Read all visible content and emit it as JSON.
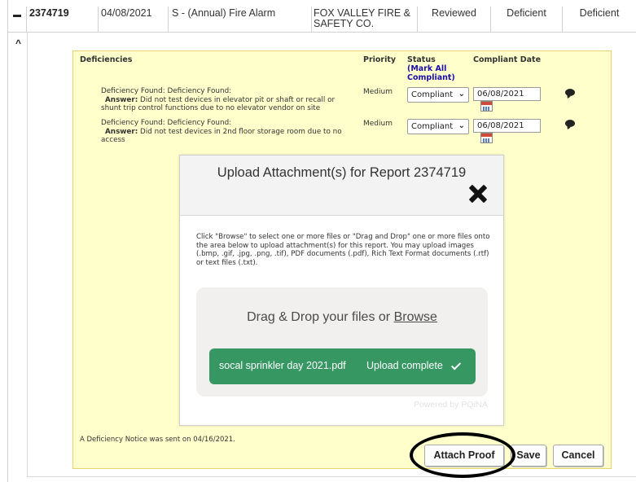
{
  "report_row": {
    "report_id": "2374719",
    "date": "04/08/2021",
    "type": "S - (Annual) Fire Alarm",
    "company": "FOX VALLEY FIRE & SAFETY CO.",
    "review_status": "Reviewed",
    "result_1": "Deficient",
    "result_2": "Deficient"
  },
  "deficiencies": {
    "headers": {
      "deficiencies": "Deficiencies",
      "priority": "Priority",
      "status": "Status",
      "mark_all": "(Mark All Compliant)",
      "compliant_date": "Compliant Date"
    },
    "items": [
      {
        "found": "Deficiency Found: Deficiency Found:",
        "answer_label": "Answer:",
        "answer_text": " Did not test devices in elevator pit or shaft or recall or shunt trip control functions due to no elevator vendor on site",
        "priority": "Medium",
        "status": "Compliant",
        "date": "06/08/2021"
      },
      {
        "found": "Deficiency Found: Deficiency Found:",
        "answer_label": "Answer:",
        "answer_text": " Did not test devices in 2nd floor storage room due to no access",
        "priority": "Medium",
        "status": "Compliant",
        "date": "06/08/2021"
      }
    ],
    "notice": "A Deficiency Notice was sent on 04/16/2021."
  },
  "modal": {
    "title": "Upload Attachment(s) for Report 2374719",
    "instructions": "Click \"Browse\" to select one or more files or \"Drag and Drop\" one or more files onto the area below to upload attachment(s) for this report. You may upload images (.bmp, .gif, .jpg, .png, .tif), PDF documents (.pdf), Rich Text Format documents (.rtf) or text files (.txt).",
    "drop_text": "Drag & Drop your files or ",
    "browse_text": "Browse",
    "file_name": "socal sprinkler day 2021.pdf",
    "file_status": "Upload complete",
    "powered_by": "Powered by PQINA",
    "success_color": "#369763"
  },
  "buttons": {
    "attach_proof": "Attach Proof",
    "save": "Save",
    "cancel": "Cancel"
  },
  "icons": {
    "collapse": "minus-icon",
    "panel_toggle": "chevron-up-icon",
    "close": "close-icon",
    "calendar": "calendar-icon",
    "comment": "comment-icon",
    "check": "check-icon"
  },
  "colors": {
    "panel_bg": "#ffffcc",
    "link": "#1a0dab"
  }
}
